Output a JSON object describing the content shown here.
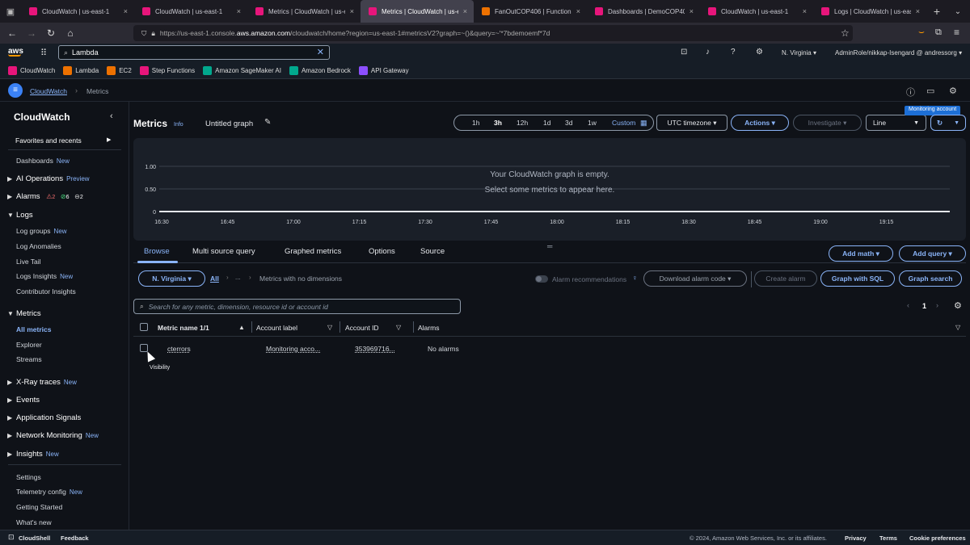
{
  "browser": {
    "tabs": [
      {
        "title": "CloudWatch | us-east-1",
        "color": "#e7157b"
      },
      {
        "title": "CloudWatch | us-east-1",
        "color": "#e7157b"
      },
      {
        "title": "Metrics | CloudWatch | us-east-1",
        "color": "#e7157b"
      },
      {
        "title": "Metrics | CloudWatch | us-east-1",
        "color": "#e7157b",
        "active": true
      },
      {
        "title": "FanOutCOP406 | Functions | La",
        "color": "#ed7100"
      },
      {
        "title": "Dashboards | DemoCOP406 | Cl",
        "color": "#e7157b"
      },
      {
        "title": "CloudWatch | us-east-1",
        "color": "#e7157b"
      },
      {
        "title": "Logs | CloudWatch | us-east-1",
        "color": "#e7157b"
      }
    ],
    "close_glyph": "×",
    "new_tab": "+",
    "tab_list": "⌄",
    "url_prefix": "https://us-east-1.console.",
    "url_domain": "aws.amazon.com",
    "url_rest": "/cloudwatch/home?region=us-east-1#metricsV2?graph=~()&query=~'*7bdemoemf*7d"
  },
  "aws": {
    "logo_text": "aws",
    "search_value": "Lambda",
    "region": "N. Virginia ▾",
    "account": "AdminRole/nikkap-Isengard @ andressorg ▾",
    "favorites": [
      {
        "label": "CloudWatch",
        "color": "#e7157b"
      },
      {
        "label": "Lambda",
        "color": "#ed7100"
      },
      {
        "label": "EC2",
        "color": "#ed7100"
      },
      {
        "label": "Step Functions",
        "color": "#e7157b"
      },
      {
        "label": "Amazon SageMaker AI",
        "color": "#01a88d"
      },
      {
        "label": "Amazon Bedrock",
        "color": "#01a88d"
      },
      {
        "label": "API Gateway",
        "color": "#8c4fff"
      }
    ]
  },
  "breadcrumb": {
    "root": "CloudWatch",
    "current": "Metrics",
    "sep": "›"
  },
  "sidebar": {
    "title": "CloudWatch",
    "collapse": "‹",
    "favorites": "Favorites and recents",
    "favorites_arrow": "▶",
    "dashboards": "Dashboards",
    "ai_operations": "AI Operations",
    "preview": "Preview",
    "alarms": "Alarms",
    "alarm_counts": {
      "alarm": "2",
      "ok": "6",
      "insufficient": "2"
    },
    "logs": "Logs",
    "log_groups": "Log groups",
    "log_anomalies": "Log Anomalies",
    "live_tail": "Live Tail",
    "logs_insights": "Logs Insights",
    "contributor_insights": "Contributor Insights",
    "metrics": "Metrics",
    "all_metrics": "All metrics",
    "explorer": "Explorer",
    "streams": "Streams",
    "xray": "X-Ray traces",
    "events": "Events",
    "app_signals": "Application Signals",
    "network": "Network Monitoring",
    "insights": "Insights",
    "settings": "Settings",
    "telemetry": "Telemetry config",
    "getting_started": "Getting Started",
    "whats_new": "What's new",
    "new_badge": "New"
  },
  "main": {
    "title": "Metrics",
    "info": "Info",
    "graph_name": "Untitled graph",
    "time_ranges": [
      "1h",
      "3h",
      "12h",
      "1d",
      "3d",
      "1w"
    ],
    "time_selected": "3h",
    "custom": "Custom",
    "timezone": "UTC timezone ▾",
    "actions": "Actions ▾",
    "investigate": "Investigate ▾",
    "chart_type": "Line",
    "monitoring_account": "Monitoring account",
    "empty_line1": "Your CloudWatch graph is empty.",
    "empty_line2": "Select some metrics to appear here.",
    "y_ticks": [
      "1.00",
      "0.50",
      "0"
    ],
    "x_ticks": [
      "16:30",
      "16:45",
      "17:00",
      "17:15",
      "17:30",
      "17:45",
      "18:00",
      "18:15",
      "18:30",
      "18:45",
      "19:00",
      "19:15"
    ],
    "tabs": [
      "Browse",
      "Multi source query",
      "Graphed metrics",
      "Options",
      "Source"
    ],
    "add_math": "Add math ▾",
    "add_query": "Add query ▾",
    "region_btn": "N. Virginia ▾",
    "all_link": "All",
    "crumb_sep": "›",
    "crumb_dots": "...",
    "no_dimensions": "Metrics with no dimensions",
    "alarm_recommendations": "Alarm recommendations",
    "download_alarm_code": "Download alarm code ▾",
    "create_alarm": "Create alarm",
    "graph_with_sql": "Graph with SQL",
    "graph_search": "Graph search",
    "search_placeholder": "Search for any metric, dimension, resource id or account id",
    "page": "1",
    "columns": [
      "Metric name 1/1",
      "Account label",
      "Account ID",
      "Alarms"
    ],
    "rows": [
      {
        "metric": "cterrors",
        "account_label": "Monitoring acco...",
        "account_id": "353969716...",
        "alarms": "No alarms"
      }
    ],
    "tooltip": "Visibility"
  },
  "footer": {
    "cloudshell": "CloudShell",
    "feedback": "Feedback",
    "copyright": "© 2024, Amazon Web Services, Inc. or its affiliates.",
    "privacy": "Privacy",
    "terms": "Terms",
    "cookies": "Cookie preferences"
  },
  "colors": {
    "accent": "#8ab4f8",
    "bg": "#0f1218",
    "panel": "#1a1f28"
  }
}
